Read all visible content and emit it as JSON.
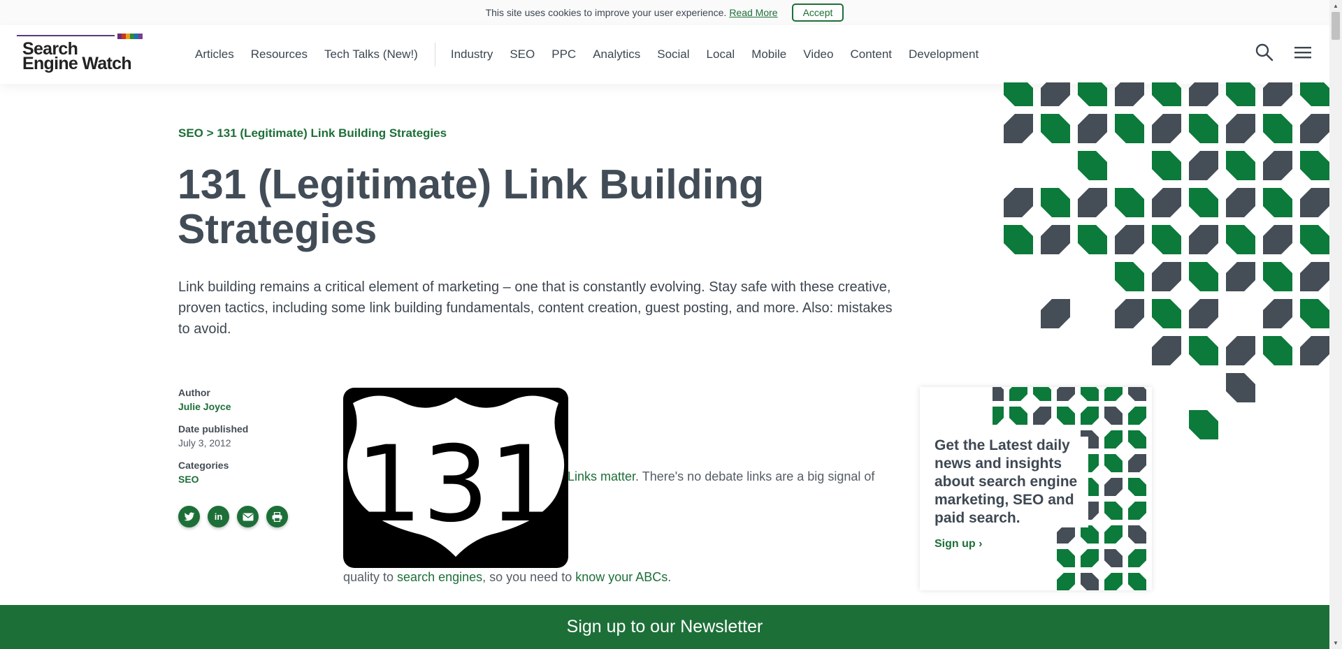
{
  "cookie": {
    "message": "This site uses cookies to improve your user experience.",
    "read_more": "Read More",
    "accept": "Accept"
  },
  "header": {
    "logo_line1": "Search",
    "logo_line2": "Engine Watch",
    "logo_colors": [
      "#6b2d7a",
      "#c8361f",
      "#e5a11c",
      "#2f8b3c",
      "#1f6fb3",
      "#7a3f91"
    ],
    "nav_primary": [
      "Articles",
      "Resources",
      "Tech Talks (New!)"
    ],
    "nav_secondary": [
      "Industry",
      "SEO",
      "PPC",
      "Analytics",
      "Social",
      "Local",
      "Mobile",
      "Video",
      "Content",
      "Development"
    ],
    "search_icon": "search-icon",
    "menu_icon": "hamburger-menu-icon"
  },
  "article": {
    "breadcrumb_category": "SEO",
    "breadcrumb_sep": ">",
    "breadcrumb_current": "131 (Legitimate) Link Building Strategies",
    "title": "131 (Legitimate) Link Building Strategies",
    "lead": "Link building remains a critical element of marketing – one that is constantly evolving. Stay safe with these creative, proven tactics, including some link building fundamentals, content creation, guest posting, and more. Also: mistakes to avoid.",
    "author_label": "Author",
    "author": "Julie Joyce",
    "date_label": "Date published",
    "date": "July 3, 2012",
    "categories_label": "Categories",
    "category": "SEO",
    "share": [
      "twitter-icon",
      "linkedin-icon",
      "email-icon",
      "print-icon"
    ],
    "shield_number": "131",
    "body_link1": "Links matter",
    "body_text1": ". There's no debate links are a big signal of",
    "body_text2a": "quality to ",
    "body_link2": "search engines",
    "body_text2b": ", so you need to ",
    "body_link3": "know your ABCs",
    "body_text2c": "."
  },
  "promo": {
    "text": "Get the Latest daily news and insights about search engine marketing, SEO and paid search.",
    "signup": "Sign up ›"
  },
  "newsletter_bar": "Sign up to our Newsletter",
  "colors": {
    "brand_green": "#1d6f38",
    "slate": "#414c57",
    "pattern_green": "#0b7a3a",
    "pattern_gray": "#454d56"
  }
}
